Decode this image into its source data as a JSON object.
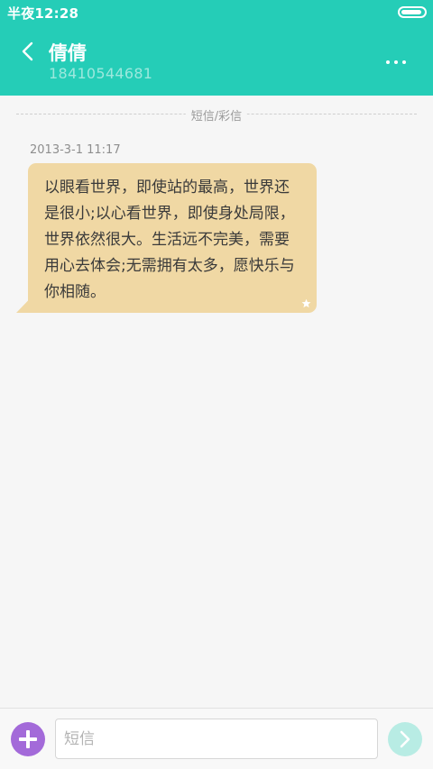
{
  "status_bar": {
    "time": "半夜12:28",
    "battery_level": 0.92
  },
  "header": {
    "contact_name": "倩倩",
    "contact_number": "18410544681",
    "back_icon": "chevron-left-icon",
    "more_icon": "more-horizontal-icon"
  },
  "thread": {
    "separator_label": "短信/彩信",
    "messages": [
      {
        "timestamp": "2013-3-1 11:17",
        "text": "以眼看世界，即使站的最高，世界还是很小;以心看世界，即使身处局限，世界依然很大。生活远不完美，需要用心去体会;无需拥有太多，愿快乐与你相随。",
        "starred": true
      }
    ]
  },
  "composer": {
    "placeholder": "短信",
    "value": "",
    "add_icon": "plus-icon",
    "send_icon": "chevron-right-icon"
  },
  "colors": {
    "header": "#25cdb7",
    "bubble": "#f0d8a4",
    "add_button": "#a36ad9",
    "send_button": "#b8ece4",
    "background": "#f6f6f6"
  }
}
